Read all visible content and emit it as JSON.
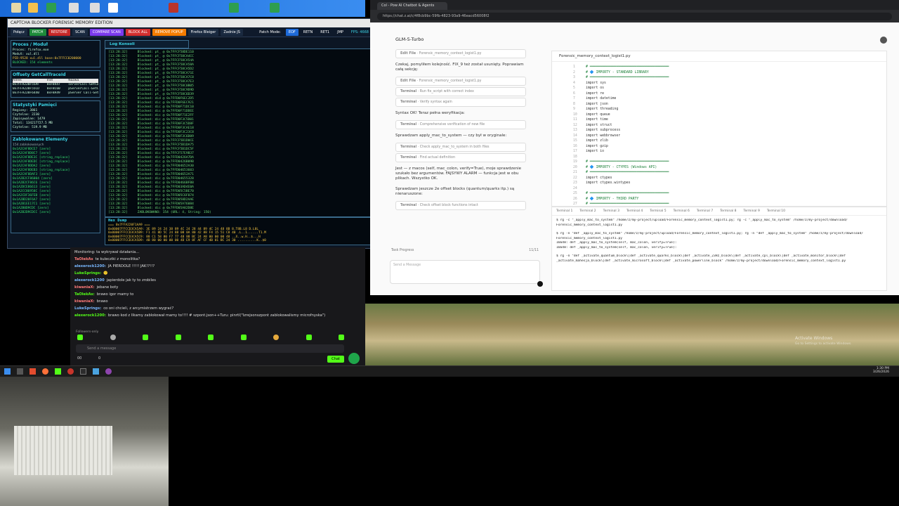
{
  "memtool": {
    "title": "CAPTCHA BLOCKER FORENSIC MEMORY EDITION",
    "buttons": [
      "Połącz",
      "PATCH",
      "RESTORE",
      "SCAN",
      "COMPARE SCAN",
      "BLOCK ALL",
      "REMOVE POPUP",
      "Firefox Bleiger",
      "Zadnie JS"
    ],
    "button_colors": [
      "#1a2a40",
      "#1e8a3a",
      "#c62828",
      "#1a2a40",
      "#7c3aed",
      "#d32f2f",
      "#f57c00",
      "#1a2a40",
      "#1a2a40"
    ],
    "patch_mode_label": "Patch Mode:",
    "modes": [
      "EOF",
      "RETN",
      "RET1",
      "JMP"
    ],
    "fps": "FPS: 4668",
    "process_panel": {
      "title": "Proces / Moduł",
      "lines": [
        "Proces: firefox.exe",
        "Moduł: xul.dll",
        "PID:9528 xul.dll base:0x7FFCC0200000",
        "BLOCKED: 154 elements"
      ]
    },
    "offsets_panel": {
      "title": "Offsety GetCallTraceId",
      "headers": [
        "Adres",
        "Inst",
        "Nazwa"
      ],
      "rows": [
        [
          "0x7FFA220F55AF",
          "0xF8447",
          "serverCall-GetCall"
        ],
        [
          "0x7FFA220F55CD",
          "0xF8C60",
          "pServerCall-GetCa"
        ],
        [
          "0x7FFA220F6440",
          "0xF8A49",
          "pServer Call-GetCo"
        ]
      ]
    },
    "stats_panel": {
      "title": "Statystyki Pamięci",
      "lines": [
        "Regiony: 3861",
        "Czytelne: 2230",
        "Zapisywalne: 1479",
        "Total: 134217727.5 MB",
        "Czytelne: 519.9 MB"
      ]
    },
    "blocked_panel": {
      "title": "Zablokowane Elementy",
      "subtitle": "154 zablokowanych",
      "items": [
        "0x1A2CAF8DCE7 [zero]",
        "0x1A2CAF8D8C7 [zero]",
        "0x1A2CAF8DE3C [string_replace]",
        "0x1A2CAF8DEDC [string_replace]",
        "0x1A2CAF8DDA2 [zero]",
        "0x1A2CAF8DEB3 [string_replace]",
        "0x1A2CAF8DAF3 [zero]",
        "0x1A2B2CF86004 [zero]",
        "0x1A2B2CF86C6 [zero]",
        "0x1A2DCE86613 [zero]",
        "0x1A2CC86958C [zero]",
        "0x1A2CDF36FEB [zero]",
        "0x1A2BD20F6A7 [zero]",
        "0x1A2B1EE17C1 [zero]",
        "0x1A2B0D9CDC [zero]",
        "0x1A2B2D9CDCC [zero]"
      ]
    },
    "log": {
      "tab": "Log Konsoli",
      "lines": [
        [
          "[13:28:32]",
          "Blocked: pt_ @ 0x7FFCF58DE110"
        ],
        [
          "[13:28:32]",
          "Blocked: pt_ @ 0x7FFCF58CA4CC"
        ],
        [
          "[13:28:32]",
          "Blocked: pt_ @ 0x7FFCF58CA54A"
        ],
        [
          "[13:28:32]",
          "Blocked: pt_ @ 0x7FFCF58CA58A"
        ],
        [
          "[13:28:32]",
          "Blocked: pt_ @ 0x7FFCF58CA5D2"
        ],
        [
          "[13:28:32]",
          "Blocked: pt_ @ 0x7FFCF58CA71E"
        ],
        [
          "[13:28:32]",
          "Blocked: pt_ @ 0x7FFCF58CA7C8"
        ],
        [
          "[13:28:32]",
          "Blocked: pt_ @ 0x7FFCF58CA7E3"
        ],
        [
          "[13:28:32]",
          "Blocked: pt_ @ 0x7FFCF58C0B05"
        ],
        [
          "[13:28:32]",
          "Blocked: pt_ @ 0x7FFCF58C9D9D"
        ],
        [
          "[13:28:32]",
          "Blocked: pt_ @ 0x7FFCF58C6D39"
        ],
        [
          "[13:28:32]",
          "Blocked: did @ 0x7FFD0F6EC2D5"
        ],
        [
          "[13:28:32]",
          "Blocked: dic @ 0x7FFD0F6EC921"
        ],
        [
          "[13:28:32]",
          "Blocked: dic @ 0x7FFD0F71DC10"
        ],
        [
          "[13:28:32]",
          "Blocked: dic @ 0x7FFD0F71DDEE"
        ],
        [
          "[13:28:32]",
          "Blocked: dic @ 0x7FFD0F71E2FF"
        ],
        [
          "[13:28:32]",
          "Blocked: dic @ 0x7FFD0F3C5D01"
        ],
        [
          "[13:28:32]",
          "Blocked: dic @ 0x7FFD0F3C5D8F"
        ],
        [
          "[13:28:32]",
          "Blocked: dic @ 0x7FFD0F3CAE18"
        ],
        [
          "[13:28:32]",
          "Blocked: dic @ 0x7FFD0F3C23C8"
        ],
        [
          "[13:28:32]",
          "Blocked: dic @ 0x7FFD0F3C6D09"
        ],
        [
          "[13:28:32]",
          "Blocked: dic @ 0x7FFCF5B1D0CE"
        ],
        [
          "[13:28:32]",
          "Blocked: dic @ 0x7FFCF5B1DA75"
        ],
        [
          "[13:28:32]",
          "Blocked: dic @ 0x7FFCF5B1DC5F"
        ],
        [
          "[13:28:32]",
          "Blocked: dic @ 0x7FFCF57E9B37"
        ],
        [
          "[13:28:32]",
          "Blocked: dic @ 0x7FFD0426A7DA"
        ],
        [
          "[13:28:32]",
          "Blocked: dic @ 0x7FFD0426B09B"
        ],
        [
          "[13:28:32]",
          "Blocked: dic @ 0x7FFD04652A30"
        ],
        [
          "[13:28:32]",
          "Blocked: dic @ 0x7FFD04653603"
        ],
        [
          "[13:28:32]",
          "Blocked: dic @ 0x7FFD04652A71"
        ],
        [
          "[13:28:32]",
          "Blocked: dic @ 0x7FFD04655328"
        ],
        [
          "[13:28:32]",
          "Blocked: dic @ 0x7FFD0466BFB8"
        ],
        [
          "[13:28:32]",
          "Blocked: dic @ 0x7FFD03AD4E0A"
        ],
        [
          "[13:28:32]",
          "Blocked: dic @ 0x7FFD05C5BE70"
        ],
        [
          "[13:28:32]",
          "Blocked: dic @ 0x7FFD05C6F074"
        ],
        [
          "[13:28:32]",
          "Blocked: dic @ 0x7FFD058D2AAE"
        ],
        [
          "[13:28:32]",
          "Blocked: dic @ 0x7FFD05A76084"
        ],
        [
          "[13:28:32]",
          "Blocked: dic @ 0x7FFD05A82D8E"
        ],
        [
          "[13:28:32]",
          "ZABLOKOWANO: 154 (URL: 4, String: 150)"
        ]
      ]
    },
    "hex": {
      "tab": "Hex Dump",
      "lines": [
        "=== 0x7FFA220F1AA9 ===",
        "0x00007FFCCD3CA5A9: 3E 89 24 24 38 89 4C 24 28 44 89 4C 24 48 8B  8.T8B.L8 D.L8L",
        "0x00007FFCCD3CA5B9: F1 41 8D 5C 24 88 08 0A 80 42 88 F4 15 51 C8 40  .L..1......T1.M",
        "0x00007FFCCD3CA5C9: 88 C1 58 80 F7 77 48 88 BC 24 A8 00 00 00 48  ..X..w.H..$...H",
        "0x00007FFCCD3CA5D9: 4B 80 00 00 00 00 4D E9 8F AF CF 4B 01 BC 24 30  ..........K..$0"
      ]
    }
  },
  "chat": {
    "messages": [
      [
        "",
        "Monitoring: ta wykrywał działania..."
      ],
      [
        "TaOlekAs",
        "te kulecziki z monolitka?"
      ],
      [
        "alexerock1200:",
        "JA PIERDOLE !!!!! JAK!?!!?"
      ],
      [
        "LukeSprings:",
        "🙂"
      ],
      [
        "alexerock1200",
        "japierdole jak ty to zrobiles"
      ],
      [
        "kiwaniaX:",
        "jebane boty"
      ],
      [
        "TaOlekAs:",
        "brawo igor mamy to"
      ],
      [
        "kiwaniaX:",
        "brawo"
      ],
      [
        "LukeSprings:",
        "co oni chcieli, z arcymistrzem wygrać?"
      ],
      [
        "alexerock1200:",
        "brawo kod z llkamy zablokował mamy to!!!! # szpont.json++Turu: pinrtl(\"Izrejsonszpont zablokowalismy microfnyska\")"
      ]
    ],
    "followers_note": "Followers-only",
    "input_placeholder": "Send a message",
    "chat_button": "Chat",
    "points_a": "00",
    "points_b": "0"
  },
  "browser": {
    "tab_title": "Col - Pow AI Chatbot & Agents",
    "url": "https://chat.z.ai/c/4f8cb9bc-59fb-4823-93a9-46eacd56008f2",
    "model": "GLM-5-Turbo",
    "paragraphs": [
      "Czekaj, pomyliłem kolejność. FIX_9 też został usunięty. Poprawiam całą sekcję:",
      "Syntax OK! Teraz pełna weryfikacja:",
      "Sprawdzam apply_mac_to_system — czy był w oryginale:",
      "Jest — z macos (self, mac_colon, verify=True), moje sprawdzenie szukało bez argumentów. FAJSYWY ALARM — funkcja jest w obu plikach. Wszystko OK.",
      "Sprawdzam jeszcze 2e offset blocks (quantum/quarks itp.) są nienaruszone:"
    ],
    "tools": [
      [
        "Edit File",
        "Forensic_memory_context_logist1.py"
      ],
      [
        "Edit File",
        "Forensic_memory_context_logist1.py"
      ],
      [
        "Terminal",
        "Run fix_script with correct index"
      ],
      [
        "Terminal",
        "Verify syntax again"
      ],
      [
        "Terminal",
        "Comprehensive verification of new file"
      ],
      [
        "Terminal",
        "Check apply_mac_to_system in both files"
      ],
      [
        "Terminal",
        "Find actual definition"
      ],
      [
        "Terminal",
        "Check offset block functions intact"
      ]
    ],
    "task_progress": "Task Progress",
    "task_count": "11/11",
    "message_placeholder": "Send a Message",
    "code_file": "Forensic_memory_context_logist1.py",
    "code_lines": [
      "# ═══════════════════════════════════════",
      "# 🔷 IMPORTY - STANDARD LIBRARY",
      "# ═══════════════════════════════════════",
      "import sys",
      "import os",
      "import re",
      "import datetime",
      "import json",
      "import threading",
      "import queue",
      "import time",
      "import struct",
      "import subprocess",
      "import webbrowser",
      "import zlib",
      "import gzip",
      "import io",
      "",
      "# ═══════════════════════════════════════",
      "# 🔷 IMPORTY - CTYPES (Windows API)",
      "# ═══════════════════════════════════════",
      "import ctypes",
      "import ctypes.wintypes",
      "",
      "# ═══════════════════════════════════════",
      "# 🔷 IMPORTY - THIRD PARTY",
      "# ═══════════════════════════════════════",
      "import psutil"
    ],
    "term_tabs": [
      "Terminal 1",
      "Terminal 2",
      "Terminal 3",
      "Terminal 4",
      "Terminal 5",
      "Terminal 6",
      "Terminal 7",
      "Terminal 8",
      "Terminal 9",
      "Terminal 10"
    ],
    "term_lines": [
      "$ rg -c \"_apply_mac_to_system\" /home/z/my-project/upload/Forensic_memory_context_logist1.py; rg -c \"_apply_mac_to_system\" /home/z/my-project/download/",
      "Forensic_memory_context_logist1.py",
      "",
      "$ rg -n \"def _apply_mac_to_system\" /home/z/my-project/upload/Forensic_memory_context_logist1.py; rg -n \"def _apply_mac_to_system\" /home/z/my-project/download/",
      "Forensic_memory_context_logist1.py",
      "16648:    def _apply_mac_to_system(self, mac_colon, verify=True):",
      "16648:    def _apply_mac_to_system(self, mac_colon, verify=True):",
      "",
      "$ rg -n \"def _activate_quantum_block\\|def _activate_quarks_block\\|def _activate_23Hz_block\\|def _activate_cpl_block\\|def _activate_monitor_block\\|def",
      "_activate_mahesja_block\\|def _activate_microsoft_block\\|def _activate_powerline_block\" /home/z/my-project/download/Forensic_memory_context_logist1.py"
    ]
  },
  "taskbar": {
    "time": "1:30 PM",
    "date": "3/26/2026"
  },
  "watermark": {
    "line1": "Activate Windows",
    "line2": "Go to Settings to activate Windows."
  }
}
